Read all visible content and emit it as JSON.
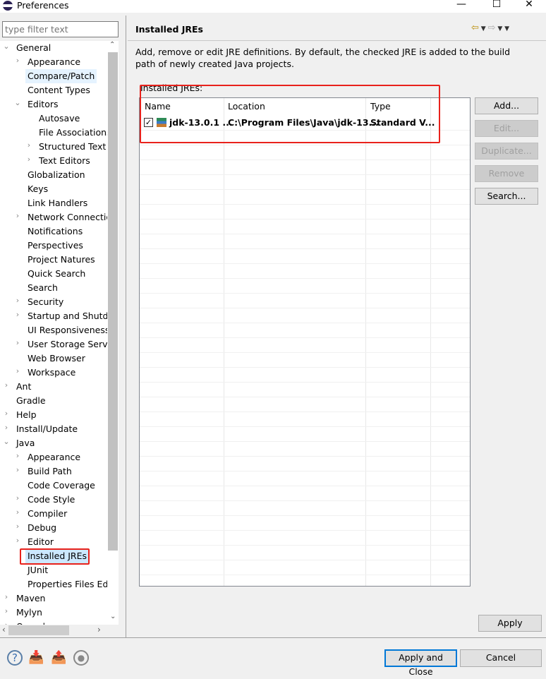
{
  "window": {
    "title": "Preferences",
    "minimize": "—",
    "maximize": "☐",
    "close": "✕"
  },
  "filter": {
    "placeholder": "type filter text"
  },
  "tree": [
    {
      "label": "General",
      "level": 0,
      "state": "open"
    },
    {
      "label": "Appearance",
      "level": 1,
      "state": "closed"
    },
    {
      "label": "Compare/Patch",
      "level": 1,
      "state": "leaf",
      "hover": true
    },
    {
      "label": "Content Types",
      "level": 1,
      "state": "leaf"
    },
    {
      "label": "Editors",
      "level": 1,
      "state": "open"
    },
    {
      "label": "Autosave",
      "level": 2,
      "state": "leaf"
    },
    {
      "label": "File Associations",
      "level": 2,
      "state": "leaf"
    },
    {
      "label": "Structured Text E",
      "level": 2,
      "state": "closed"
    },
    {
      "label": "Text Editors",
      "level": 2,
      "state": "closed"
    },
    {
      "label": "Globalization",
      "level": 1,
      "state": "leaf"
    },
    {
      "label": "Keys",
      "level": 1,
      "state": "leaf"
    },
    {
      "label": "Link Handlers",
      "level": 1,
      "state": "leaf"
    },
    {
      "label": "Network Connectio",
      "level": 1,
      "state": "closed"
    },
    {
      "label": "Notifications",
      "level": 1,
      "state": "leaf"
    },
    {
      "label": "Perspectives",
      "level": 1,
      "state": "leaf"
    },
    {
      "label": "Project Natures",
      "level": 1,
      "state": "leaf"
    },
    {
      "label": "Quick Search",
      "level": 1,
      "state": "leaf"
    },
    {
      "label": "Search",
      "level": 1,
      "state": "leaf"
    },
    {
      "label": "Security",
      "level": 1,
      "state": "closed"
    },
    {
      "label": "Startup and Shutdo",
      "level": 1,
      "state": "closed"
    },
    {
      "label": "UI Responsiveness",
      "level": 1,
      "state": "leaf"
    },
    {
      "label": "User Storage Servic",
      "level": 1,
      "state": "closed"
    },
    {
      "label": "Web Browser",
      "level": 1,
      "state": "leaf"
    },
    {
      "label": "Workspace",
      "level": 1,
      "state": "closed"
    },
    {
      "label": "Ant",
      "level": 0,
      "state": "closed"
    },
    {
      "label": "Gradle",
      "level": 0,
      "state": "leaf"
    },
    {
      "label": "Help",
      "level": 0,
      "state": "closed"
    },
    {
      "label": "Install/Update",
      "level": 0,
      "state": "closed"
    },
    {
      "label": "Java",
      "level": 0,
      "state": "open"
    },
    {
      "label": "Appearance",
      "level": 1,
      "state": "closed"
    },
    {
      "label": "Build Path",
      "level": 1,
      "state": "closed"
    },
    {
      "label": "Code Coverage",
      "level": 1,
      "state": "leaf"
    },
    {
      "label": "Code Style",
      "level": 1,
      "state": "closed"
    },
    {
      "label": "Compiler",
      "level": 1,
      "state": "closed"
    },
    {
      "label": "Debug",
      "level": 1,
      "state": "closed"
    },
    {
      "label": "Editor",
      "level": 1,
      "state": "closed"
    },
    {
      "label": "Installed JREs",
      "level": 1,
      "state": "leaf",
      "selected": true
    },
    {
      "label": "JUnit",
      "level": 1,
      "state": "leaf"
    },
    {
      "label": "Properties Files Edi",
      "level": 1,
      "state": "leaf"
    },
    {
      "label": "Maven",
      "level": 0,
      "state": "closed"
    },
    {
      "label": "Mylyn",
      "level": 0,
      "state": "closed"
    },
    {
      "label": "Oomph",
      "level": 0,
      "state": "closed"
    }
  ],
  "page": {
    "title": "Installed JREs",
    "description": "Add, remove or edit JRE definitions. By default, the checked JRE is added to the build path of newly created Java projects.",
    "table_label": "Installed JREs:",
    "columns": [
      "Name",
      "Location",
      "Type"
    ],
    "rows": [
      {
        "checked": true,
        "name": "jdk-13.0.1 ...",
        "location": "C:\\Program Files\\Java\\jdk-13...",
        "type": "Standard V..."
      }
    ],
    "buttons": [
      {
        "label": "Add...",
        "enabled": true
      },
      {
        "label": "Edit...",
        "enabled": false
      },
      {
        "label": "Duplicate...",
        "enabled": false
      },
      {
        "label": "Remove",
        "enabled": false
      },
      {
        "label": "Search...",
        "enabled": true
      }
    ],
    "apply": "Apply"
  },
  "footer": {
    "apply_close": "Apply and Close",
    "cancel": "Cancel"
  },
  "colors": {
    "highlight": "#e8221c",
    "selection": "#cce8ff",
    "default_button": "#0078d7"
  }
}
